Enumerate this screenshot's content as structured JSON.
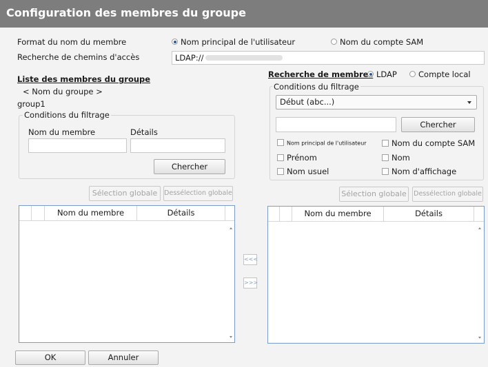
{
  "window": {
    "title": "Configuration des membres du groupe"
  },
  "format": {
    "label": "Format du nom du membre",
    "option_principal": "Nom principal de l'utilisateur",
    "option_sam": "Nom du compte SAM",
    "selected": "principal"
  },
  "path": {
    "label": "Recherche de chemins d'accès",
    "value": "LDAP://"
  },
  "left": {
    "title": "Liste des membres du groupe",
    "group_name_label": "< Nom du groupe >",
    "group_name": "group1",
    "filter": {
      "legend": "Conditions du filtrage",
      "member_label": "Nom du membre",
      "details_label": "Détails",
      "search_button": "Chercher"
    },
    "select_all": "Sélection globale",
    "deselect_all": "Dessélection globale",
    "grid": {
      "columns": [
        "Nom du membre",
        "Détails"
      ]
    }
  },
  "right": {
    "title": "Recherche de membres",
    "source_ldap": "LDAP",
    "source_local": "Compte local",
    "source_selected": "LDAP",
    "filter": {
      "legend": "Conditions du filtrage",
      "dropdown_value": "Début (abc...)",
      "search_button": "Chercher",
      "checkboxes": {
        "principal": "Nom principal de l'utilisateur",
        "sam": "Nom du compte SAM",
        "firstname": "Prénom",
        "name": "Nom",
        "usual": "Nom usuel",
        "display": "Nom d'affichage"
      }
    },
    "select_all": "Sélection globale",
    "deselect_all": "Dessélection globale",
    "grid": {
      "columns": [
        "Nom du membre",
        "Détails"
      ]
    }
  },
  "transfer": {
    "add": "<<<",
    "remove": ">>>"
  },
  "footer": {
    "ok": "OK",
    "cancel": "Annuler"
  },
  "colors": {
    "titlebar": "#7d7d7d",
    "grid_border": "#7a9ccc",
    "background": "#f3f3f3"
  }
}
